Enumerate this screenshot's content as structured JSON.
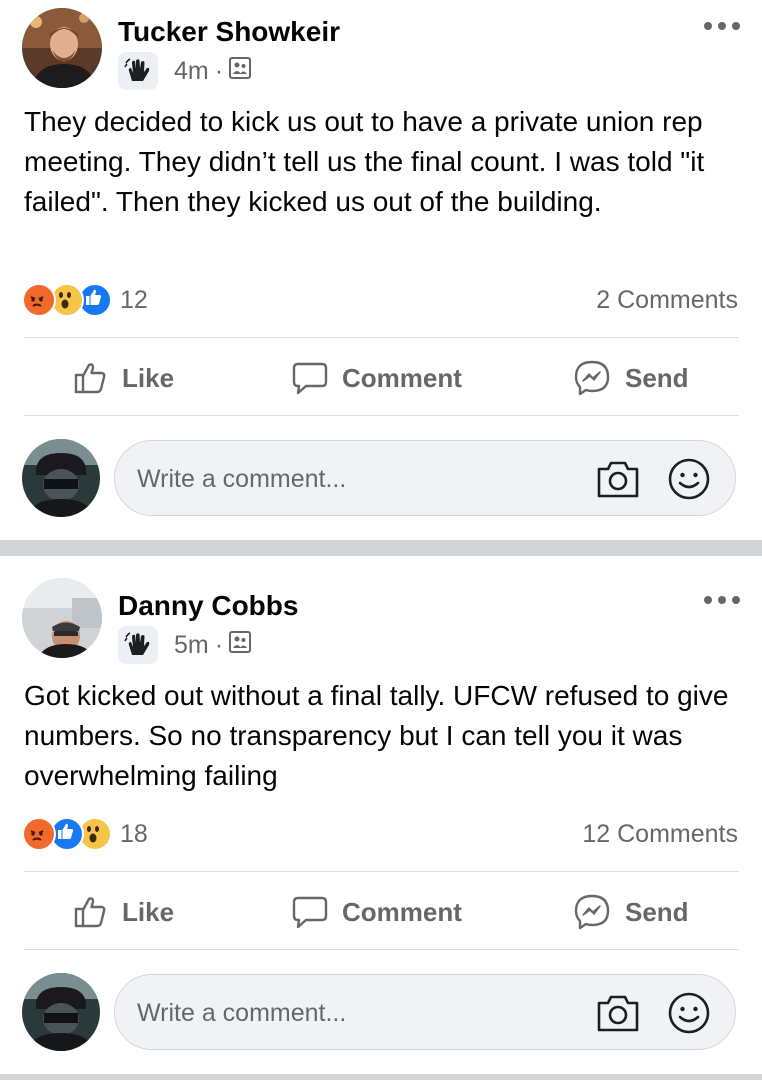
{
  "posts": [
    {
      "author": "Tucker Showkeir",
      "time": "4m",
      "separator": "·",
      "badge_icon": "waving-hand-icon",
      "audience_icon": "group-audience-icon",
      "body": "They decided to kick us out to have a private union rep meeting. They didn’t tell us the final count. I was told \"it failed\". Then they kicked us out of the building.",
      "reactions": [
        "angry",
        "wow",
        "like"
      ],
      "reaction_count": "12",
      "comments_count": "2 Comments",
      "actions": {
        "like": "Like",
        "comment": "Comment",
        "send": "Send"
      },
      "comment_placeholder": "Write a comment..."
    },
    {
      "author": "Danny Cobbs",
      "time": "5m",
      "separator": "·",
      "badge_icon": "waving-hand-icon",
      "audience_icon": "group-audience-icon",
      "body": "Got kicked out without a final tally. UFCW refused to give numbers. So no transparency but I can tell you it was overwhelming failing",
      "reactions": [
        "angry",
        "like",
        "wow"
      ],
      "reaction_count": "18",
      "comments_count": "12 Comments",
      "actions": {
        "like": "Like",
        "comment": "Comment",
        "send": "Send"
      },
      "comment_placeholder": "Write a comment..."
    }
  ],
  "colors": {
    "angry": "#f2692c",
    "wow": "#f7c44a",
    "like": "#1877f2",
    "secondary_text": "#65676b",
    "input_bg": "#f0f2f5"
  }
}
